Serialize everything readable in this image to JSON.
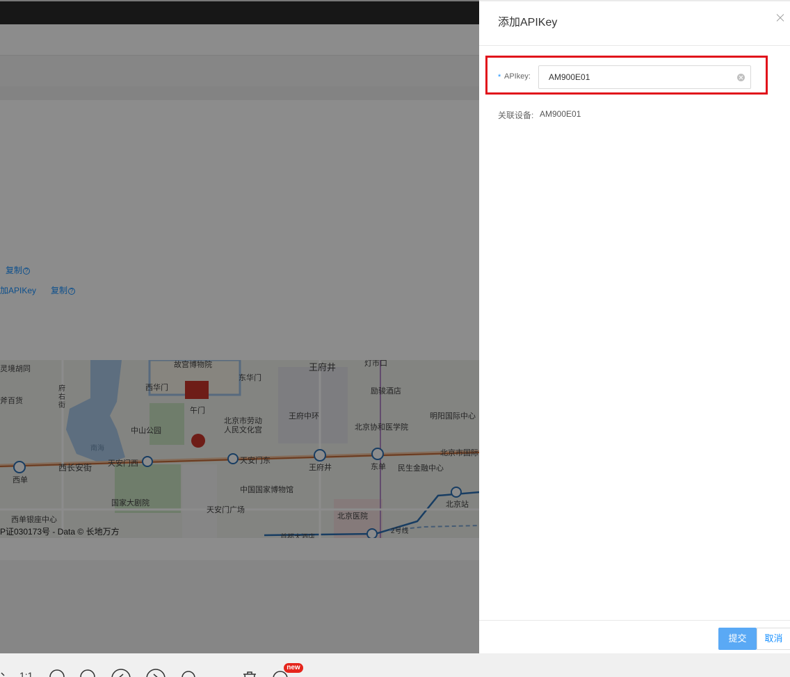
{
  "background": {
    "links": [
      {
        "text": "复制",
        "help": "?"
      },
      {
        "text": "加APIKey"
      },
      {
        "text": "复制",
        "help": "?"
      }
    ],
    "map": {
      "labels": [
        "灵境胡同",
        "故宫博物院",
        "王府井",
        "灯市口",
        "东华门",
        "西华门",
        "府右街",
        "午门",
        "励骏酒店",
        "斧百货",
        "中山公园",
        "王府中环",
        "北京市劳动人民文化宫",
        "北京协和医学院",
        "明阳国际中心",
        "南海",
        "北京市国际",
        "西单",
        "西长安街",
        "天安门西",
        "天安门东",
        "王府井",
        "东单",
        "民生金融中心",
        "国家大剧院",
        "中国国家博物馆",
        "北京站",
        "北京医院",
        "天安门广场",
        "西单银座中心",
        "首都大酒店",
        "2号线"
      ],
      "copyright": "P证030173号 - Data © 长地万方"
    }
  },
  "drawer": {
    "title": "添加APIKey",
    "close_label": "×",
    "apikey": {
      "required_mark": "*",
      "label": "APIkey:",
      "value": "AM900E01"
    },
    "associated_device": {
      "label": "关联设备:",
      "value": "AM900E01"
    },
    "submit_label": "提交",
    "cancel_label": "取消"
  },
  "toolbar": {
    "ratio_label": "1:1",
    "new_badge": "new"
  },
  "colors": {
    "accent": "#1890ff",
    "highlight": "#e1121b",
    "submit": "#5aa9f5"
  }
}
